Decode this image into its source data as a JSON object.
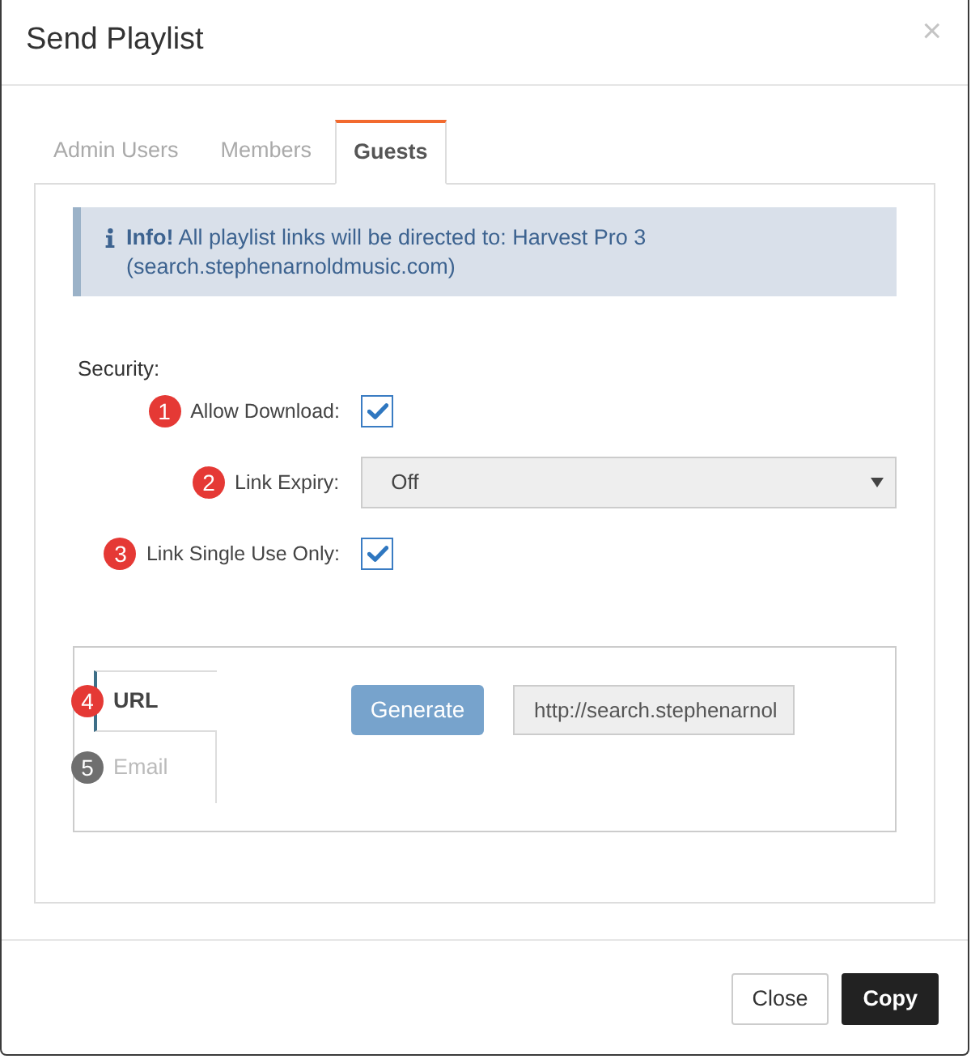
{
  "window": {
    "title": "Send Playlist",
    "close": "×"
  },
  "tabs": [
    {
      "label": "Admin Users",
      "selected": false
    },
    {
      "label": "Members",
      "selected": false
    },
    {
      "label": "Guests",
      "selected": true
    }
  ],
  "info": {
    "text": "**Info!** All playlist links will be directed to: Harvest Pro 3 (search.stephenarnoldmusic.com)"
  },
  "security": {
    "heading": "Security:",
    "rows": [
      {
        "kind": "checkbox",
        "marker": {
          "text": "1",
          "color": "#e53935"
        },
        "label": "Allow Download:",
        "checked": true
      },
      {
        "kind": "select",
        "marker": {
          "text": "2",
          "color": "#e53935"
        },
        "label": "Link Expiry:",
        "value": "Off"
      },
      {
        "kind": "checkbox",
        "marker": {
          "text": "3",
          "color": "#e53935"
        },
        "label": "Link Single Use Only:",
        "checked": true
      }
    ]
  },
  "link_panel": {
    "tabs": [
      {
        "label": "URL",
        "selected": true,
        "marker": {
          "text": "4",
          "color": "#e53935"
        }
      },
      {
        "label": "Email",
        "selected": false,
        "marker": {
          "text": "5",
          "color": "#6f6f6f"
        }
      }
    ],
    "generate_button": "Generate",
    "url_value": "http://search.stephenarnol"
  },
  "footer": {
    "buttons": [
      {
        "label": "Close",
        "kind": "default"
      },
      {
        "label": "Copy",
        "kind": "primary"
      }
    ]
  }
}
